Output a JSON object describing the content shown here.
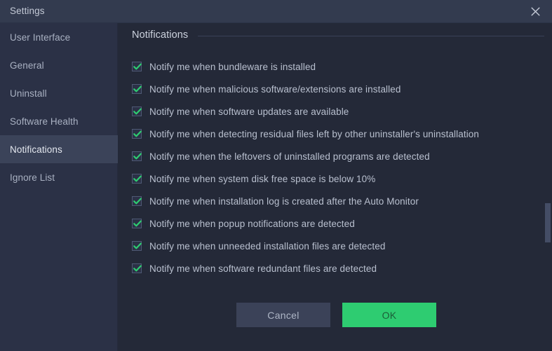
{
  "window": {
    "title": "Settings",
    "close_icon": "close-icon"
  },
  "sidebar": {
    "items": [
      {
        "label": "User Interface",
        "selected": false
      },
      {
        "label": "General",
        "selected": false
      },
      {
        "label": "Uninstall",
        "selected": false
      },
      {
        "label": "Software Health",
        "selected": false
      },
      {
        "label": "Notifications",
        "selected": true
      },
      {
        "label": "Ignore List",
        "selected": false
      }
    ]
  },
  "content": {
    "section_title": "Notifications",
    "options": [
      {
        "label": "Notify me when bundleware is installed",
        "checked": true
      },
      {
        "label": "Notify me when malicious software/extensions are installed",
        "checked": true
      },
      {
        "label": "Notify me when software updates are available",
        "checked": true
      },
      {
        "label": "Notify me when detecting residual files left by other uninstaller's uninstallation",
        "checked": true
      },
      {
        "label": "Notify me when the leftovers of uninstalled programs are detected",
        "checked": true
      },
      {
        "label": "Notify me when system disk free space is below 10%",
        "checked": true
      },
      {
        "label": "Notify me when installation log is created after the Auto Monitor",
        "checked": true
      },
      {
        "label": "Notify me when popup notifications are detected",
        "checked": true
      },
      {
        "label": "Notify me when unneeded installation files are detected",
        "checked": true
      },
      {
        "label": "Notify me when software redundant files are detected",
        "checked": true
      }
    ]
  },
  "buttons": {
    "cancel_label": "Cancel",
    "ok_label": "OK"
  },
  "colors": {
    "window_bg": "#242938",
    "titlebar_bg": "#333b4f",
    "sidebar_bg": "#2b3146",
    "sidebar_selected_bg": "#3b4359",
    "accent_green": "#2ecc71",
    "check_green": "#2ecc71",
    "text_primary": "#ccd2de",
    "text_secondary": "#b9c0cf",
    "scrollbar_thumb": "#444d66"
  }
}
